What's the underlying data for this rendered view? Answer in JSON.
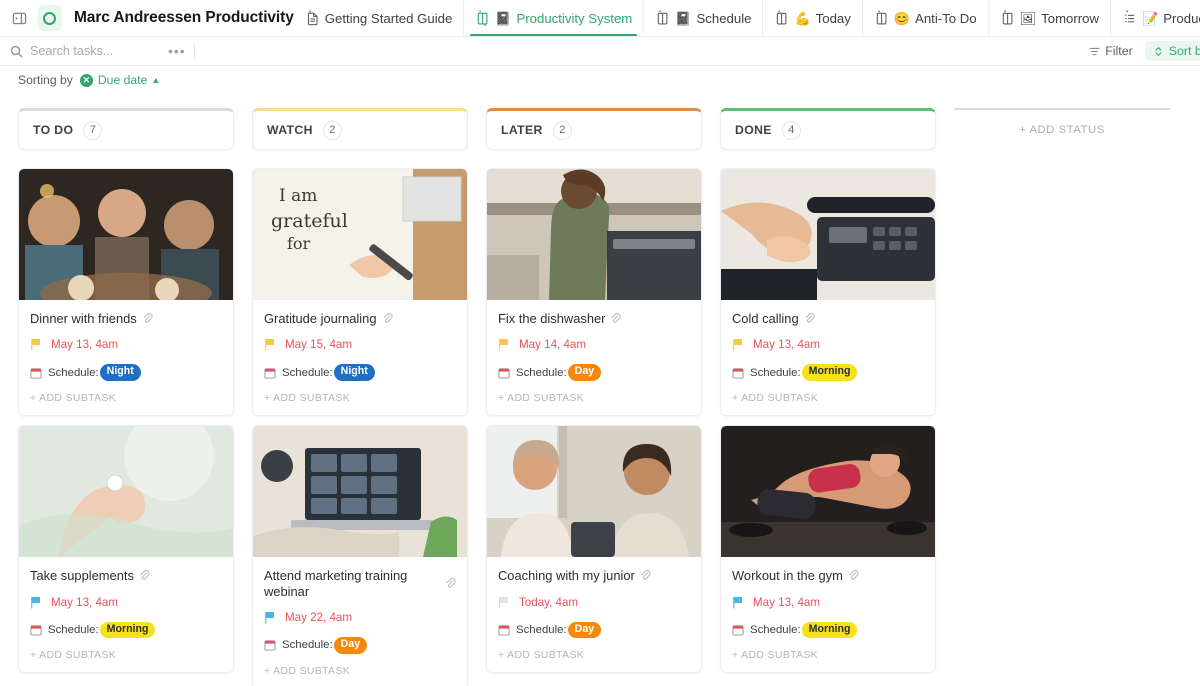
{
  "topbar": {
    "panel_toggle_icon": "panel-toggle-icon",
    "space": {
      "name": "Marc Andreessen Productivity",
      "icon": "circle-status-icon"
    },
    "tabs": [
      {
        "label": "Getting Started Guide",
        "icon": "doc-icon",
        "emoji": "",
        "active": false
      },
      {
        "label": "Productivity System",
        "icon": "board-icon",
        "emoji": "📓",
        "active": true
      },
      {
        "label": "Schedule",
        "icon": "board-icon",
        "emoji": "📓",
        "active": false
      },
      {
        "label": "Today",
        "icon": "board-icon",
        "emoji": "💪",
        "active": false
      },
      {
        "label": "Anti-To Do",
        "icon": "board-icon",
        "emoji": "😊",
        "active": false
      },
      {
        "label": "Tomorrow",
        "icon": "board-icon",
        "emoji": "🖼",
        "active": false
      },
      {
        "label": "Productivity List",
        "icon": "list-icon",
        "emoji": "📝",
        "active": false
      }
    ]
  },
  "toolbar": {
    "search_placeholder": "Search tasks...",
    "search_value": "",
    "more_label": "•••",
    "filter_label": "Filter",
    "sort_label": "Sort by"
  },
  "sorting": {
    "prefix": "Sorting by",
    "field": "Due date",
    "direction_caret": "▲",
    "clear_icon": "✕"
  },
  "board": {
    "add_status_label": "+ ADD STATUS",
    "add_subtask_label": "+ ADD SUBTASK",
    "schedule_field_label": "Schedule:",
    "columns": [
      {
        "title": "TO DO",
        "count": "7",
        "accent": "#d9dce0",
        "cards": [
          {
            "title": "Dinner with friends",
            "date": "May 13, 4am",
            "flag": "yellow",
            "tag": {
              "text": "Night",
              "bg": "#1f6fc4",
              "fg": "#ffffff"
            },
            "cover": "friends-dinner-photo"
          },
          {
            "title": "Take supplements",
            "date": "May 13, 4am",
            "flag": "blue",
            "tag": {
              "text": "Morning",
              "bg": "#f5e21a",
              "fg": "#2b2d32"
            },
            "cover": "hand-holding-pill-photo"
          }
        ]
      },
      {
        "title": "WATCH",
        "count": "2",
        "accent": "#f2dd8e",
        "cards": [
          {
            "title": "Gratitude journaling",
            "date": "May 15, 4am",
            "flag": "yellow",
            "tag": {
              "text": "Night",
              "bg": "#1f6fc4",
              "fg": "#ffffff"
            },
            "cover": "gratitude-notebook-photo"
          },
          {
            "title": "Attend marketing training webinar",
            "date": "May 22, 4am",
            "flag": "blue",
            "tag": {
              "text": "Day",
              "bg": "#f5880d",
              "fg": "#ffffff"
            },
            "cover": "laptop-video-call-photo"
          }
        ]
      },
      {
        "title": "LATER",
        "count": "2",
        "accent": "#e08b4e",
        "cards": [
          {
            "title": "Fix the dishwasher",
            "date": "May 14, 4am",
            "flag": "yellow",
            "tag": {
              "text": "Day",
              "bg": "#f5880d",
              "fg": "#ffffff"
            },
            "cover": "kitchen-dishwasher-photo"
          },
          {
            "title": "Coaching with my junior",
            "date": "Today, 4am",
            "flag": "gray",
            "tag": {
              "text": "Day",
              "bg": "#f5880d",
              "fg": "#ffffff"
            },
            "cover": "two-women-talking-photo"
          }
        ]
      },
      {
        "title": "DONE",
        "count": "4",
        "accent": "#5fbf72",
        "cards": [
          {
            "title": "Cold calling",
            "date": "May 13, 4am",
            "flag": "yellow",
            "tag": {
              "text": "Morning",
              "bg": "#f5e21a",
              "fg": "#2b2d32"
            },
            "cover": "hand-on-desk-phone-photo"
          },
          {
            "title": "Workout in the gym",
            "date": "May 13, 4am",
            "flag": "blue",
            "tag": {
              "text": "Morning",
              "bg": "#f5e21a",
              "fg": "#2b2d32"
            },
            "cover": "gym-pushup-photo"
          }
        ]
      }
    ]
  }
}
